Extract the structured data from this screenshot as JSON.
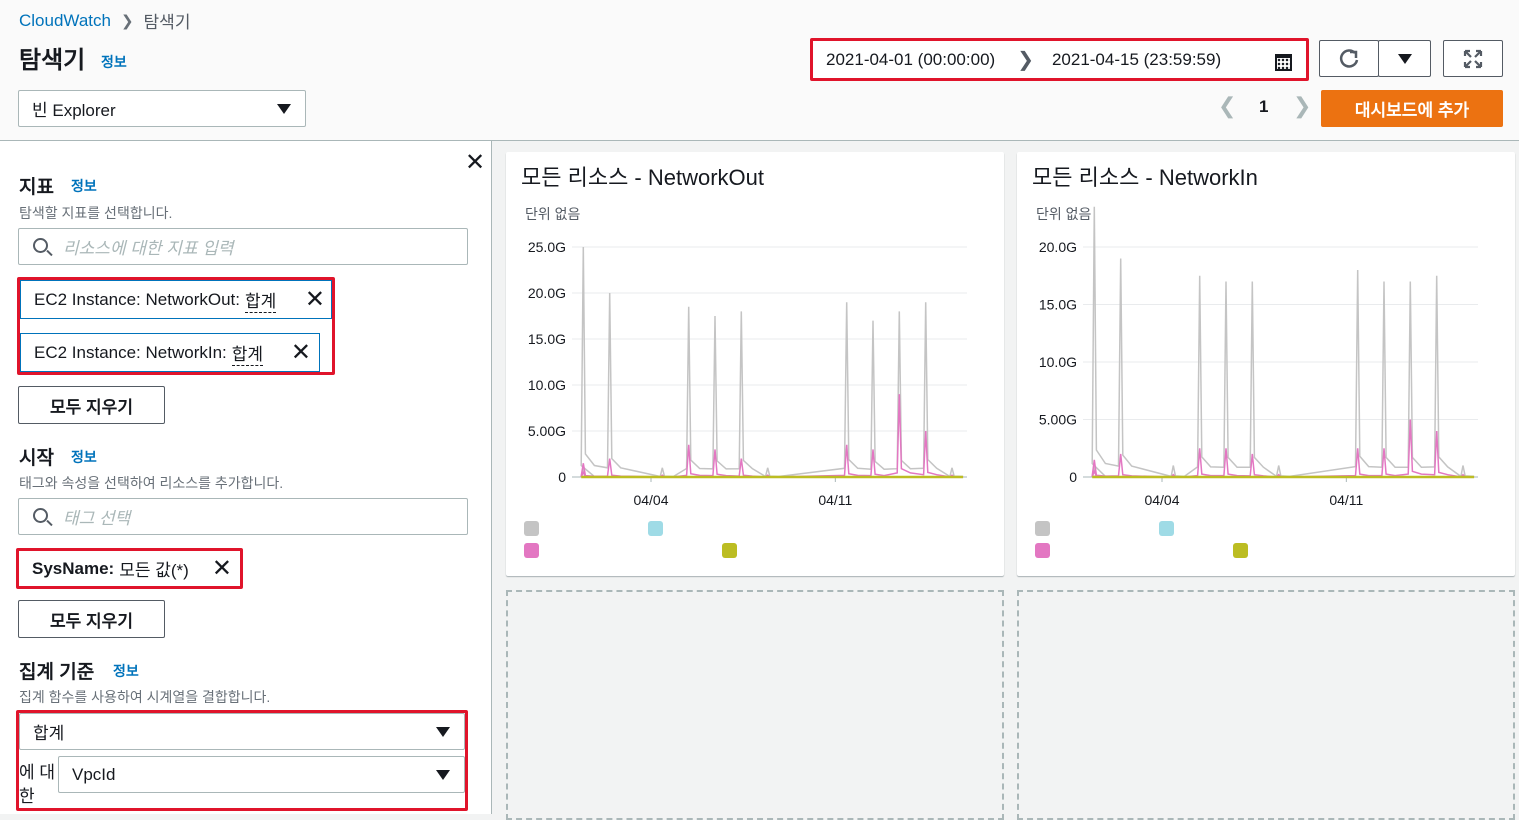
{
  "breadcrumb": {
    "root": "CloudWatch",
    "current": "탐색기"
  },
  "header": {
    "title": "탐색기",
    "info": "정보",
    "explorer_select": "빈 Explorer",
    "date_start": "2021-04-01 (00:00:00)",
    "date_end": "2021-04-15 (23:59:59)",
    "page": "1",
    "add_to_dashboard": "대시보드에 추가"
  },
  "sidebar": {
    "metrics": {
      "title": "지표",
      "info": "정보",
      "desc": "탐색할 지표를 선택합니다.",
      "placeholder": "리소스에 대한 지표 입력",
      "tokens": [
        {
          "label": "EC2 Instance: NetworkOut:",
          "stat": "합계"
        },
        {
          "label": "EC2 Instance: NetworkIn:",
          "stat": "합계"
        }
      ],
      "clear": "모두 지우기"
    },
    "from": {
      "title": "시작",
      "info": "정보",
      "desc": "태그와 속성을 선택하여 리소스를 추가합니다.",
      "placeholder": "태그 선택",
      "token_key": "SysName:",
      "token_value": "모든 값(*)",
      "clear": "모두 지우기"
    },
    "aggregate": {
      "title": "집계 기준",
      "info": "정보",
      "desc": "집계 함수를 사용하여 시계열을 결합합니다.",
      "function": "합계",
      "for_label": "에 대한",
      "group_by": "VpcId"
    }
  },
  "charts": {
    "networkout": {
      "title": "모든 리소스 - NetworkOut",
      "unit": "단위 없음",
      "yticks": [
        "25.0G",
        "20.0G",
        "15.0G",
        "10.0G",
        "5.00G",
        "0"
      ],
      "xticks": [
        "04/04",
        "04/11"
      ]
    },
    "networkin": {
      "title": "모든 리소스 - NetworkIn",
      "unit": "단위 없음",
      "yticks": [
        "20.0G",
        "15.0G",
        "10.0G",
        "5.00G",
        "0"
      ],
      "xticks": [
        "04/04",
        "04/11"
      ]
    }
  },
  "colors": {
    "series_gray": "#c4c4c4",
    "series_cyan": "#9fdbe6",
    "series_pink": "#e377c2",
    "series_olive": "#bcbd22",
    "accent_orange": "#ec7211",
    "highlight_red": "#e0142b"
  },
  "chart_data": [
    {
      "type": "line",
      "title": "모든 리소스 - NetworkOut",
      "ylabel": "단위 없음",
      "ylim": [
        0,
        25
      ],
      "xlim": [
        "2021-04-01",
        "2021-04-15"
      ],
      "x": [
        "2021-04-01",
        "2021-04-01",
        "2021-04-02",
        "2021-04-04",
        "2021-04-05",
        "2021-04-06",
        "2021-04-07",
        "2021-04-08",
        "2021-04-11",
        "2021-04-12",
        "2021-04-13",
        "2021-04-14",
        "2021-04-15"
      ],
      "series": [
        {
          "values": [
            1.0,
            25.0,
            20.0,
            1.0,
            18.5,
            17.5,
            18.0,
            1.0,
            19.0,
            17.0,
            18.0,
            19.0,
            1.0
          ]
        },
        {
          "values": [
            0,
            0,
            0,
            0,
            0,
            0,
            0,
            0,
            0,
            0,
            0,
            0,
            0
          ]
        },
        {
          "values": [
            0.5,
            1.5,
            2.0,
            0.2,
            3.5,
            3.0,
            2.0,
            0.2,
            3.5,
            3.0,
            9.0,
            5.0,
            0.2
          ]
        },
        {
          "values": [
            0,
            0,
            0,
            0,
            0,
            0,
            0,
            0,
            0,
            0,
            0,
            0,
            0
          ]
        }
      ]
    },
    {
      "type": "line",
      "title": "모든 리소스 - NetworkIn",
      "ylabel": "단위 없음",
      "ylim": [
        0,
        20
      ],
      "xlim": [
        "2021-04-01",
        "2021-04-15"
      ],
      "x": [
        "2021-04-01",
        "2021-04-01",
        "2021-04-02",
        "2021-04-04",
        "2021-04-05",
        "2021-04-06",
        "2021-04-07",
        "2021-04-08",
        "2021-04-11",
        "2021-04-12",
        "2021-04-13",
        "2021-04-14",
        "2021-04-15"
      ],
      "series": [
        {
          "values": [
            1.0,
            23.5,
            19.0,
            1.0,
            17.5,
            17.0,
            17.0,
            1.0,
            18.0,
            17.0,
            17.0,
            17.5,
            1.0
          ]
        },
        {
          "values": [
            0,
            0,
            0,
            0,
            0,
            0,
            0,
            0,
            0,
            0,
            0,
            0,
            0
          ]
        },
        {
          "values": [
            0.5,
            1.5,
            2.0,
            0.2,
            2.5,
            2.5,
            2.0,
            0.2,
            2.5,
            2.5,
            5.0,
            4.0,
            0.2
          ]
        },
        {
          "values": [
            0,
            0,
            0,
            0,
            0,
            0,
            0,
            0,
            0,
            0,
            0,
            0,
            0
          ]
        }
      ]
    }
  ]
}
